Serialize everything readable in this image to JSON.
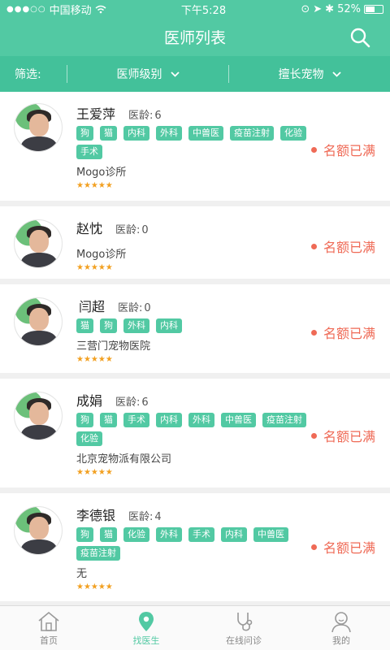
{
  "status_bar": {
    "carrier": "中国移动",
    "time": "下午5:28",
    "battery": "52%"
  },
  "header": {
    "title": "医师列表"
  },
  "filter": {
    "label": "筛选:",
    "level": "医师级别",
    "pet": "擅长宠物"
  },
  "age_label": "医龄:",
  "doctors": [
    {
      "name": "王爱萍",
      "age": "6",
      "tags": [
        "狗",
        "猫",
        "内科",
        "外科",
        "中兽医",
        "疫苗注射",
        "化验",
        "手术"
      ],
      "clinic": "Mogo诊所",
      "stars": "★★★★★",
      "status": "名额已满"
    },
    {
      "name": "赵忱",
      "age": "0",
      "tags": [],
      "clinic": "Mogo诊所",
      "stars": "★★★★★",
      "status": "名额已满"
    },
    {
      "name": "闫超",
      "age": "0",
      "tags": [
        "猫",
        "狗",
        "外科",
        "内科"
      ],
      "clinic": "三营门宠物医院",
      "stars": "★★★★★",
      "status": "名额已满"
    },
    {
      "name": "成娟",
      "age": "6",
      "tags": [
        "狗",
        "猫",
        "手术",
        "内科",
        "外科",
        "中兽医",
        "疫苗注射",
        "化验"
      ],
      "clinic": "北京宠物派有限公司",
      "stars": "★★★★★",
      "status": "名额已满"
    },
    {
      "name": "李德银",
      "age": "4",
      "tags": [
        "狗",
        "猫",
        "化验",
        "外科",
        "手术",
        "内科",
        "中兽医",
        "疫苗注射"
      ],
      "clinic": "无",
      "stars": "★★★★★",
      "status": "名额已满"
    }
  ],
  "tabs": [
    {
      "label": "首页",
      "icon": "home-icon"
    },
    {
      "label": "找医生",
      "icon": "location-pin-icon"
    },
    {
      "label": "在线问诊",
      "icon": "stethoscope-icon"
    },
    {
      "label": "我的",
      "icon": "user-icon"
    }
  ],
  "colors": {
    "accent": "#52c9a3",
    "alert": "#ef6a56",
    "star": "#f2a021"
  }
}
